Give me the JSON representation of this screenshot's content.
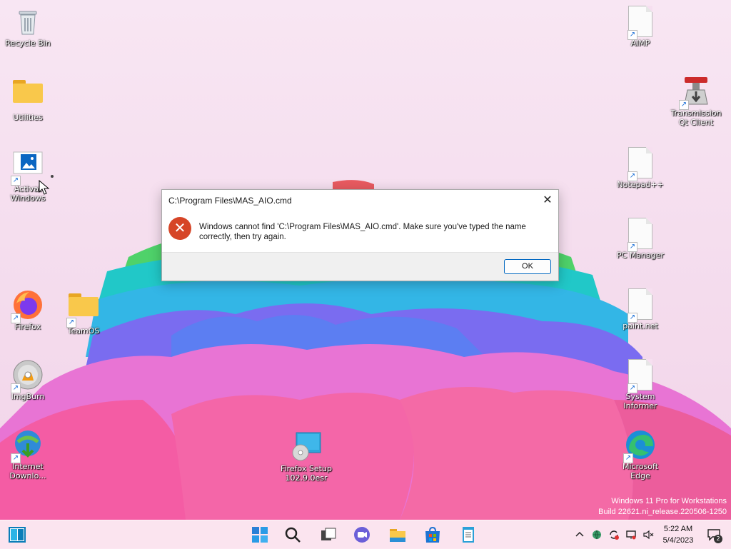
{
  "desktop": {
    "icons_left": [
      {
        "id": "recycle-bin",
        "label": "Recycle Bin",
        "icon": "recycle-bin-icon"
      },
      {
        "id": "utilities",
        "label": "Utilities",
        "icon": "folder-icon"
      },
      {
        "id": "activate-windows",
        "label": "Activat\nWindows",
        "icon": "picture-icon"
      },
      {
        "id": "firefox",
        "label": "Firefox",
        "icon": "firefox-icon"
      },
      {
        "id": "teamos",
        "label": "TeamOS",
        "icon": "folder-icon"
      },
      {
        "id": "imgburn",
        "label": "ImgBurn",
        "icon": "disc-icon"
      },
      {
        "id": "internet-download",
        "label": "Internet\nDownlo...",
        "icon": "idm-icon"
      },
      {
        "id": "firefox-setup",
        "label": "Firefox Setup\n102.9.0esr",
        "icon": "setup-icon"
      }
    ],
    "icons_right": [
      {
        "id": "aimp",
        "label": "AIMP",
        "icon": "document-icon"
      },
      {
        "id": "transmission",
        "label": "Transmission\nQt Client",
        "icon": "transmission-icon"
      },
      {
        "id": "notepad-plus",
        "label": "Notepad++",
        "icon": "document-icon"
      },
      {
        "id": "pc-manager",
        "label": "PC Manager",
        "icon": "document-icon"
      },
      {
        "id": "paint-net",
        "label": "paint.net",
        "icon": "document-icon"
      },
      {
        "id": "system-informer",
        "label": "System\nInformer",
        "icon": "document-icon"
      },
      {
        "id": "microsoft-edge",
        "label": "Microsoft\nEdge",
        "icon": "edge-icon"
      }
    ]
  },
  "dialog": {
    "title": "C:\\Program Files\\MAS_AIO.cmd",
    "message": "Windows cannot find 'C:\\Program Files\\MAS_AIO.cmd'. Make sure you've typed the name correctly, then try again.",
    "ok_label": "OK",
    "close_glyph": "✕",
    "error_glyph": "✕"
  },
  "watermark": {
    "line1": "Windows 11 Pro for Workstations",
    "line2": "Build 22621.ni_release.220506-1250"
  },
  "taskbar": {
    "items": [
      "start-icon",
      "search-icon",
      "task-view-icon",
      "chat-icon",
      "file-explorer-icon",
      "microsoft-store-icon",
      "notepad-icon"
    ],
    "tray": [
      "chevron-up-icon",
      "network-globe-icon",
      "sync-icon",
      "device-icon",
      "volume-mute-icon"
    ],
    "time": "5:22 AM",
    "date": "5/4/2023",
    "notification_count": "2"
  },
  "colors": {
    "accent": "#0067c0",
    "error_red": "#d64527",
    "wallpaper_bg": "#f6dff0"
  }
}
